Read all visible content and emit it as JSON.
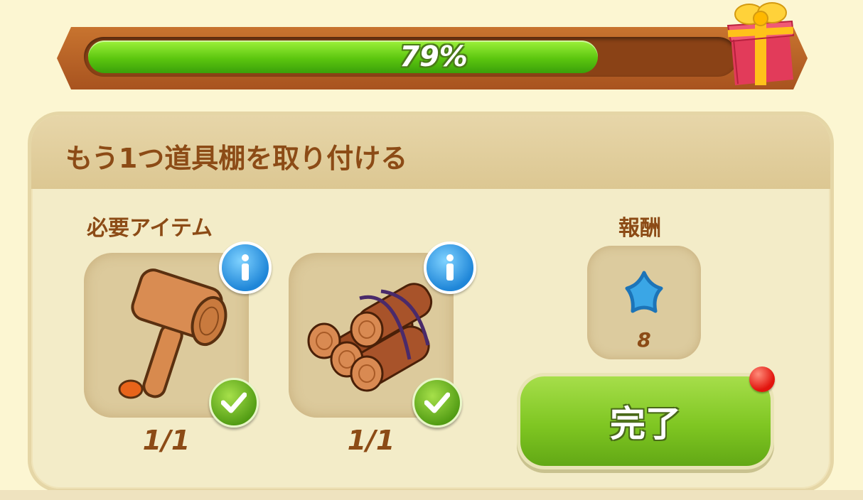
{
  "progress": {
    "percent": 0.79,
    "label": "79%"
  },
  "quest": {
    "title": "もう1つ道具棚を取り付ける"
  },
  "required": {
    "label": "必要アイテム",
    "items": [
      {
        "icon": "mallet-icon",
        "count": "1/1",
        "complete": true
      },
      {
        "icon": "logs-icon",
        "count": "1/1",
        "complete": true
      }
    ]
  },
  "reward": {
    "label": "報酬",
    "icon": "blue-star-icon",
    "count": "8"
  },
  "complete_button": {
    "label": "完了",
    "has_notification": true
  }
}
